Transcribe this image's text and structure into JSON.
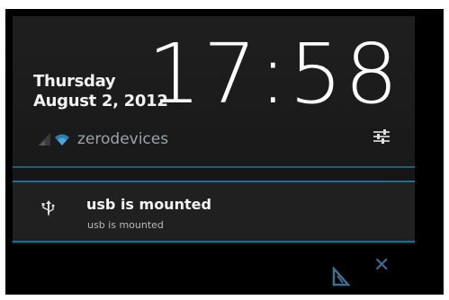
{
  "header": {
    "day": "Thursday",
    "date": "August 2, 2012",
    "time": "17:58",
    "carrier": "zerodevices"
  },
  "notification": {
    "title": "usb is mounted",
    "text": "usb is mounted"
  },
  "icons": {
    "signal": "signal-icon",
    "wifi": "wifi-icon",
    "settings": "settings-sliders-icon",
    "usb": "usb-icon",
    "clear": "clear-all-icon",
    "close": "close-icon"
  },
  "colors": {
    "accent": "#1b6f96",
    "carrier_text": "#9aa4a8"
  }
}
